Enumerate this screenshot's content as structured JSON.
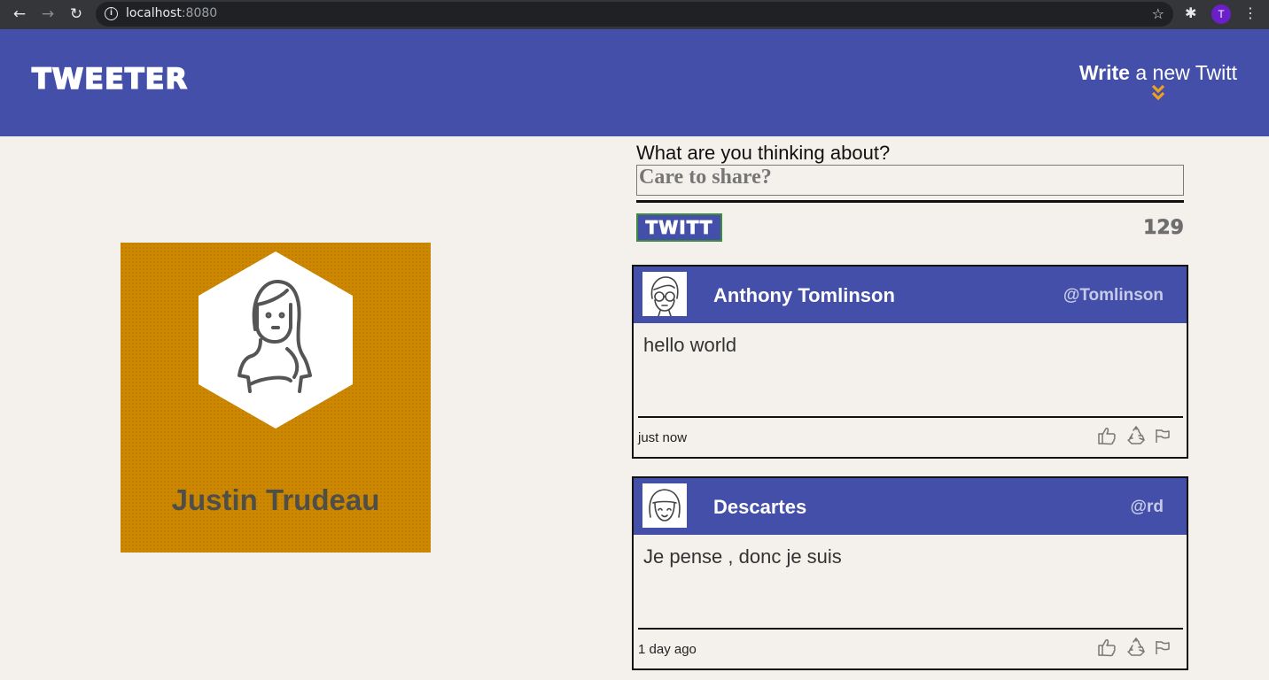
{
  "browser": {
    "url_host": "localhost",
    "url_port": ":8080",
    "profile_initial": "T"
  },
  "header": {
    "logo": "TWEETER",
    "compose_bold": "Write",
    "compose_rest": " a new Twitt",
    "compose_chevron": "»"
  },
  "profile": {
    "name": "Justin Trudeau"
  },
  "compose": {
    "prompt": "What are you thinking about?",
    "placeholder": "Care to share?",
    "button_label": "TWITT",
    "counter": "129"
  },
  "tweets": [
    {
      "author": "Anthony Tomlinson",
      "handle": "@Tomlinson",
      "text": "hello world",
      "time": "just now"
    },
    {
      "author": "Descartes",
      "handle": "@rd",
      "text": "Je pense , donc je suis",
      "time": "1 day ago"
    }
  ],
  "colors": {
    "header_bg": "#434fa8",
    "page_bg": "#f4f1ec",
    "profile_bg": "#cd8700",
    "accent_chevron": "#f0a020"
  }
}
